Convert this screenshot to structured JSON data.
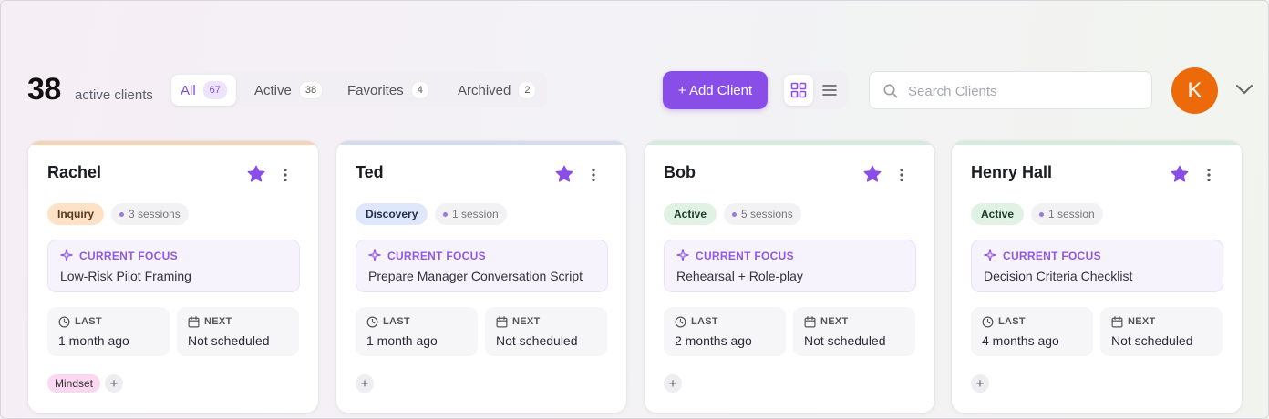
{
  "header": {
    "count": "38",
    "count_label": "active clients",
    "tabs": [
      {
        "label": "All",
        "badge": "67"
      },
      {
        "label": "Active",
        "badge": "38"
      },
      {
        "label": "Favorites",
        "badge": "4"
      },
      {
        "label": "Archived",
        "badge": "2"
      }
    ],
    "add_button": "+ Add Client",
    "search_placeholder": "Search Clients",
    "avatar_initial": "K"
  },
  "labels": {
    "current_focus": "CURRENT FOCUS",
    "last": "LAST",
    "next": "NEXT"
  },
  "colors": {
    "accent": "#8a4ee8",
    "avatar": "#ed6a0b"
  },
  "cards": [
    {
      "name": "Rachel",
      "status": "Inquiry",
      "sessions": "3 sessions",
      "focus": "Low-Risk Pilot Framing",
      "last": "1 month ago",
      "next": "Not scheduled",
      "tag": "Mindset",
      "topbar_color": "#f6d3b3",
      "status_bg": "#fde2c7",
      "status_color": "#5a3a1a"
    },
    {
      "name": "Ted",
      "status": "Discovery",
      "sessions": "1 session",
      "focus": "Prepare Manager Conversation Script",
      "last": "1 month ago",
      "next": "Not scheduled",
      "topbar_color": "#d5dcef",
      "status_bg": "#dfe7fb",
      "status_color": "#1f2d4f"
    },
    {
      "name": "Bob",
      "status": "Active",
      "sessions": "5 sessions",
      "focus": "Rehearsal + Role-play",
      "last": "2 months ago",
      "next": "Not scheduled",
      "topbar_color": "#d5ebdc",
      "status_bg": "#dff2e4",
      "status_color": "#1d3b26"
    },
    {
      "name": "Henry Hall",
      "status": "Active",
      "sessions": "1 session",
      "focus": "Decision Criteria Checklist",
      "last": "4 months ago",
      "next": "Not scheduled",
      "topbar_color": "#d5ebdc",
      "status_bg": "#dff2e4",
      "status_color": "#1d3b26"
    }
  ]
}
